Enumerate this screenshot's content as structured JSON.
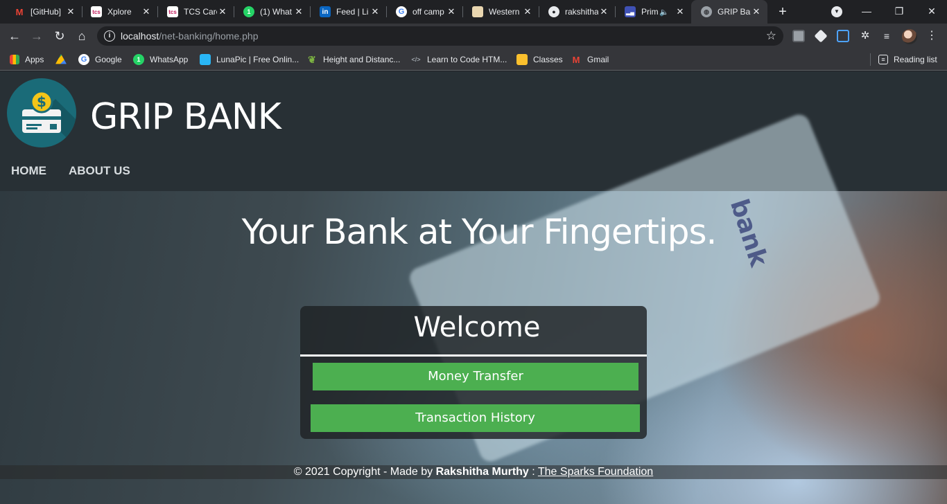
{
  "browser": {
    "tabs": [
      {
        "title": "[GitHub]",
        "icon": "gmail-icon",
        "color": "#ea4335"
      },
      {
        "title": "Xplore",
        "icon": "tcs-icon",
        "color": "#c2185b"
      },
      {
        "title": "TCS Care",
        "icon": "tcs-icon",
        "color": "#c2185b"
      },
      {
        "title": "(1) What",
        "icon": "whatsapp-icon",
        "color": "#25d366"
      },
      {
        "title": "Feed | Li",
        "icon": "linkedin-icon",
        "color": "#0a66c2"
      },
      {
        "title": "off camp",
        "icon": "google-icon",
        "color": "#4285f4"
      },
      {
        "title": "Western",
        "icon": "western-icon",
        "color": "#e0c080"
      },
      {
        "title": "rakshitha",
        "icon": "github-icon",
        "color": "#ffffff"
      },
      {
        "title": "Prim",
        "icon": "prime-icon",
        "color": "#3f51b5"
      },
      {
        "title": "GRIP Bar",
        "icon": "globe-icon",
        "color": "#9aa0a6"
      }
    ],
    "url_host": "localhost",
    "url_path": "/net-banking/home.php",
    "bookmarks": [
      {
        "label": "Apps",
        "icon": "apps-grid-icon",
        "color": "#ea4335"
      },
      {
        "label": "",
        "icon": "google-drive-icon",
        "color": "#fbbc04"
      },
      {
        "label": "Google",
        "icon": "google-icon",
        "color": "#4285f4"
      },
      {
        "label": "WhatsApp",
        "icon": "whatsapp-icon",
        "color": "#25d366"
      },
      {
        "label": "LunaPic | Free Onlin...",
        "icon": "lunapic-icon",
        "color": "#29b6f6"
      },
      {
        "label": "Height and Distanc...",
        "icon": "leaf-icon",
        "color": "#7cb342"
      },
      {
        "label": "Learn to Code HTM...",
        "icon": "code-icon",
        "color": "#9aa0a6"
      },
      {
        "label": "Classes",
        "icon": "classroom-icon",
        "color": "#fbc02d"
      },
      {
        "label": "Gmail",
        "icon": "gmail-icon",
        "color": "#ea4335"
      }
    ],
    "reading_list": "Reading list"
  },
  "site": {
    "title": "GRIP BANK",
    "nav": [
      "HOME",
      "ABOUT US"
    ],
    "hero_title": "Your Bank at Your Fingertips.",
    "hero_card_text": "bank",
    "welcome": "Welcome",
    "buttons": {
      "transfer": "Money Transfer",
      "history": "Transaction History"
    },
    "footer": {
      "prefix": "© 2021 Copyright - Made by ",
      "author": "Rakshitha Murthy",
      "sep": " : ",
      "link": "The Sparks Foundation"
    },
    "accent": "#4caf50",
    "header_bg": "#283035"
  }
}
